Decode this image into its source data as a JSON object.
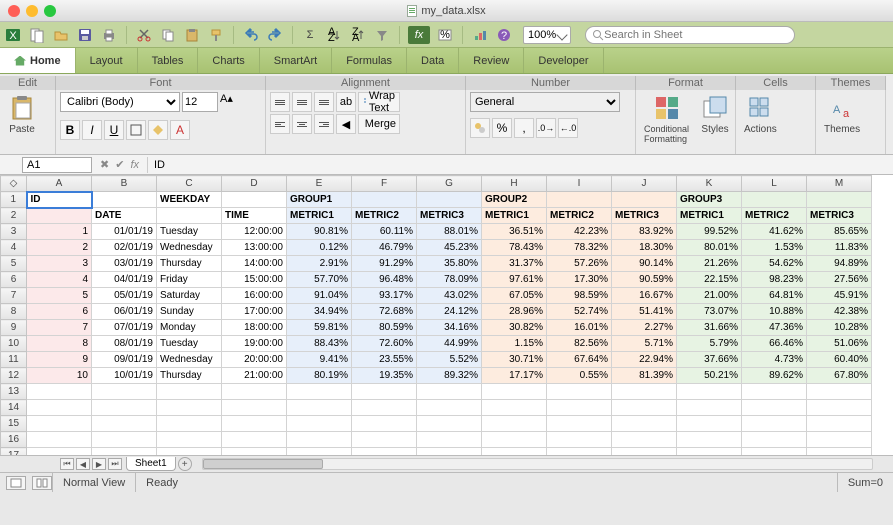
{
  "window": {
    "title": "my_data.xlsx"
  },
  "qat": {
    "zoom": "100%",
    "search_placeholder": "Search in Sheet"
  },
  "ribbon": {
    "tabs": {
      "home": "Home",
      "layout": "Layout",
      "tables": "Tables",
      "charts": "Charts",
      "smartart": "SmartArt",
      "formulas": "Formulas",
      "data": "Data",
      "review": "Review",
      "developer": "Developer"
    },
    "groups": {
      "edit": "Edit",
      "font": "Font",
      "alignment": "Alignment",
      "number": "Number",
      "format": "Format",
      "cells": "Cells",
      "themes": "Themes"
    },
    "paste": "Paste",
    "wrap": "Wrap Text",
    "merge": "Merge",
    "number_format": "General",
    "cond_fmt": "Conditional Formatting",
    "styles": "Styles",
    "actions": "Actions",
    "themes_btn": "Themes",
    "font_name": "Calibri (Body)",
    "font_size": "12"
  },
  "cellref": {
    "name": "A1",
    "fx_value": "ID"
  },
  "columns": [
    "A",
    "B",
    "C",
    "D",
    "E",
    "F",
    "G",
    "H",
    "I",
    "J",
    "K",
    "L",
    "M"
  ],
  "headers": {
    "r1": {
      "A": "ID",
      "C": "WEEKDAY",
      "E": "GROUP1",
      "H": "GROUP2",
      "K": "GROUP3"
    },
    "r2": {
      "B": "DATE",
      "D": "TIME",
      "E": "METRIC1",
      "F": "METRIC2",
      "G": "METRIC3",
      "H": "METRIC1",
      "I": "METRIC2",
      "J": "METRIC3",
      "K": "METRIC1",
      "L": "METRIC2",
      "M": "METRIC3"
    }
  },
  "rows": [
    {
      "id": "1",
      "date": "01/01/19",
      "weekday": "Tuesday",
      "time": "12:00:00",
      "g1": [
        "90.81%",
        "60.11%",
        "88.01%"
      ],
      "g2": [
        "36.51%",
        "42.23%",
        "83.92%"
      ],
      "g3": [
        "99.52%",
        "41.62%",
        "85.65%"
      ]
    },
    {
      "id": "2",
      "date": "02/01/19",
      "weekday": "Wednesday",
      "time": "13:00:00",
      "g1": [
        "0.12%",
        "46.79%",
        "45.23%"
      ],
      "g2": [
        "78.43%",
        "78.32%",
        "18.30%"
      ],
      "g3": [
        "80.01%",
        "1.53%",
        "11.83%"
      ]
    },
    {
      "id": "3",
      "date": "03/01/19",
      "weekday": "Thursday",
      "time": "14:00:00",
      "g1": [
        "2.91%",
        "91.29%",
        "35.80%"
      ],
      "g2": [
        "31.37%",
        "57.26%",
        "90.14%"
      ],
      "g3": [
        "21.26%",
        "54.62%",
        "94.89%"
      ]
    },
    {
      "id": "4",
      "date": "04/01/19",
      "weekday": "Friday",
      "time": "15:00:00",
      "g1": [
        "57.70%",
        "96.48%",
        "78.09%"
      ],
      "g2": [
        "97.61%",
        "17.30%",
        "90.59%"
      ],
      "g3": [
        "22.15%",
        "98.23%",
        "27.56%"
      ]
    },
    {
      "id": "5",
      "date": "05/01/19",
      "weekday": "Saturday",
      "time": "16:00:00",
      "g1": [
        "91.04%",
        "93.17%",
        "43.02%"
      ],
      "g2": [
        "67.05%",
        "98.59%",
        "16.67%"
      ],
      "g3": [
        "21.00%",
        "64.81%",
        "45.91%"
      ]
    },
    {
      "id": "6",
      "date": "06/01/19",
      "weekday": "Sunday",
      "time": "17:00:00",
      "g1": [
        "34.94%",
        "72.68%",
        "24.12%"
      ],
      "g2": [
        "28.96%",
        "52.74%",
        "51.41%"
      ],
      "g3": [
        "73.07%",
        "10.88%",
        "42.38%"
      ]
    },
    {
      "id": "7",
      "date": "07/01/19",
      "weekday": "Monday",
      "time": "18:00:00",
      "g1": [
        "59.81%",
        "80.59%",
        "34.16%"
      ],
      "g2": [
        "30.82%",
        "16.01%",
        "2.27%"
      ],
      "g3": [
        "31.66%",
        "47.36%",
        "10.28%"
      ]
    },
    {
      "id": "8",
      "date": "08/01/19",
      "weekday": "Tuesday",
      "time": "19:00:00",
      "g1": [
        "88.43%",
        "72.60%",
        "44.99%"
      ],
      "g2": [
        "1.15%",
        "82.56%",
        "5.71%"
      ],
      "g3": [
        "5.79%",
        "66.46%",
        "51.06%"
      ]
    },
    {
      "id": "9",
      "date": "09/01/19",
      "weekday": "Wednesday",
      "time": "20:00:00",
      "g1": [
        "9.41%",
        "23.55%",
        "5.52%"
      ],
      "g2": [
        "30.71%",
        "67.64%",
        "22.94%"
      ],
      "g3": [
        "37.66%",
        "4.73%",
        "60.40%"
      ]
    },
    {
      "id": "10",
      "date": "10/01/19",
      "weekday": "Thursday",
      "time": "21:00:00",
      "g1": [
        "80.19%",
        "19.35%",
        "89.32%"
      ],
      "g2": [
        "17.17%",
        "0.55%",
        "81.39%"
      ],
      "g3": [
        "50.21%",
        "89.62%",
        "67.80%"
      ]
    }
  ],
  "sheets": {
    "sheet1": "Sheet1"
  },
  "status": {
    "view": "Normal View",
    "ready": "Ready",
    "sum": "Sum=0"
  }
}
